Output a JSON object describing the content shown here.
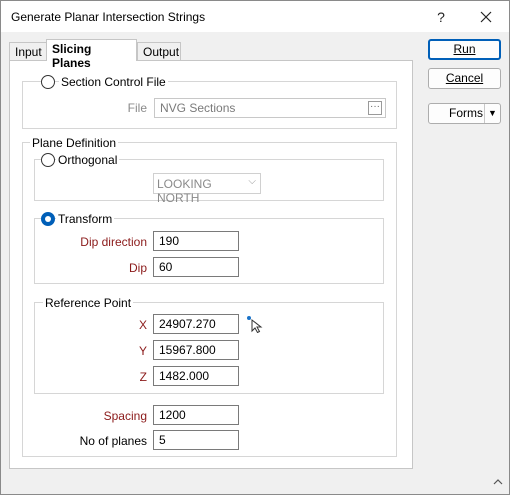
{
  "window": {
    "title": "Generate Planar Intersection Strings",
    "help_label": "?",
    "close_label": "✕"
  },
  "tabs": [
    {
      "label": "Input"
    },
    {
      "label": "Slicing Planes",
      "active": true
    },
    {
      "label": "Output"
    }
  ],
  "section_control": {
    "radio_label": "Section Control File",
    "file_label": "File",
    "file_value": "NVG Sections",
    "browse_label": "..."
  },
  "plane_definition": {
    "group_label": "Plane Definition",
    "orthogonal": {
      "radio_label": "Orthogonal",
      "selected_value": "LOOKING NORTH"
    },
    "transform": {
      "radio_label": "Transform",
      "dip_direction_label": "Dip direction",
      "dip_direction_value": "190",
      "dip_label": "Dip",
      "dip_value": "60"
    },
    "reference_point": {
      "group_label": "Reference Point",
      "x_label": "X",
      "x_value": "24907.270",
      "y_label": "Y",
      "y_value": "15967.800",
      "z_label": "Z",
      "z_value": "1482.000"
    },
    "spacing_label": "Spacing",
    "spacing_value": "1200",
    "no_of_planes_label": "No of planes",
    "no_of_planes_value": "5"
  },
  "buttons": {
    "run_label": "Run",
    "cancel_label": "Cancel",
    "forms_label": "Forms",
    "forms_dropdown": "▼"
  },
  "colors": {
    "accent": "#005fb8",
    "required_label": "#8b1a1a"
  },
  "icons": {
    "pick_point": "pick-point-icon",
    "browse": "browse-icon",
    "scroll_up": "chevron-up-icon"
  }
}
